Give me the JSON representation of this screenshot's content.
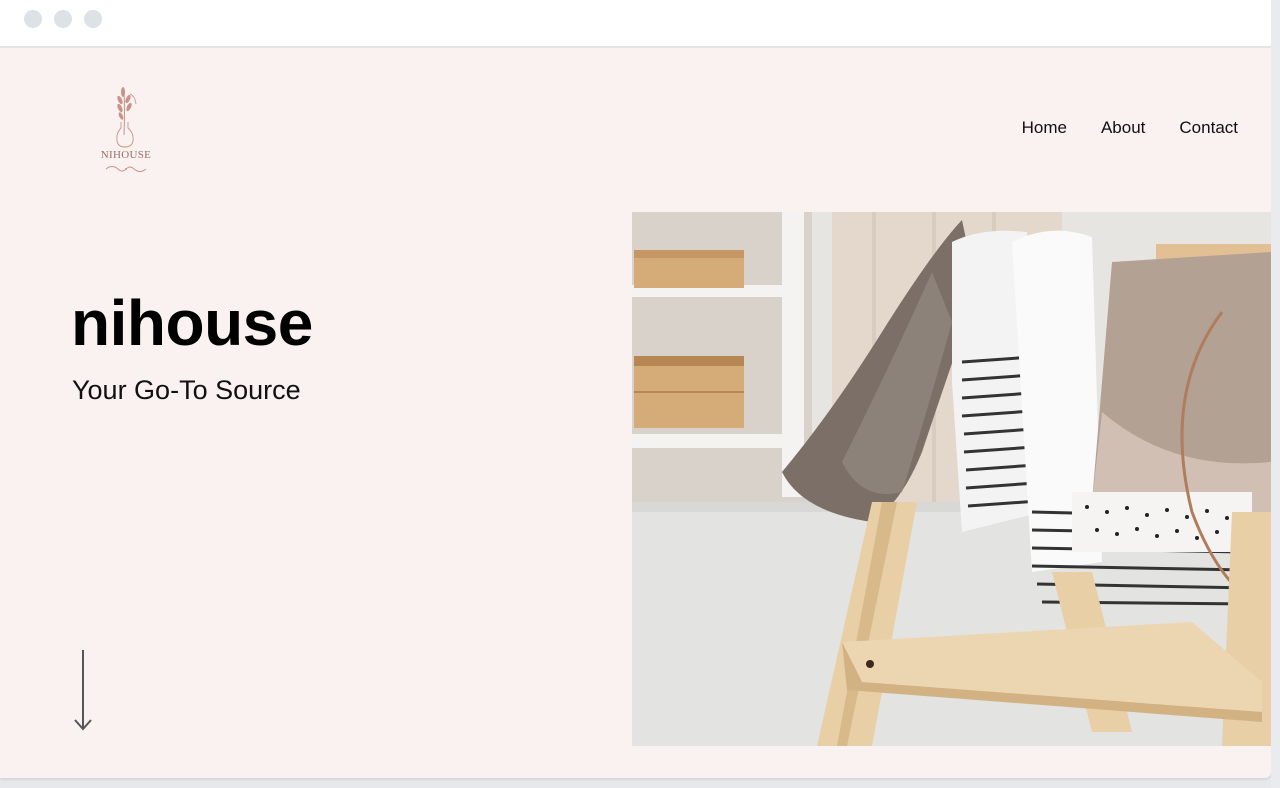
{
  "brand": {
    "logo_text": "NIHOUSE",
    "accent_color": "#c9928a"
  },
  "nav": {
    "items": [
      {
        "label": "Home"
      },
      {
        "label": "About"
      },
      {
        "label": "Contact"
      }
    ]
  },
  "hero": {
    "title": "nihouse",
    "subtitle": "Your Go-To Source",
    "background_color": "#f9f2f1",
    "image_subject": "children's clothing rack"
  },
  "icons": {
    "scroll": "arrow-down-icon",
    "logo": "plant-vase-icon"
  }
}
